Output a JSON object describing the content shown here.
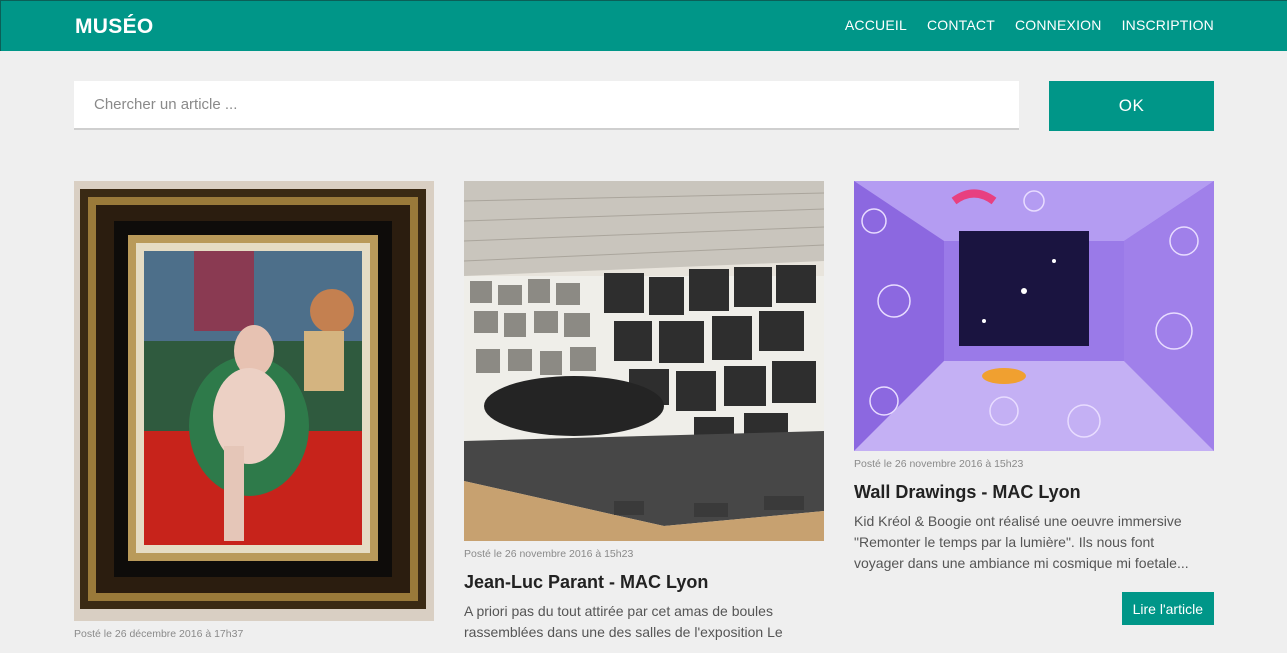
{
  "header": {
    "brand": "MUSÉO",
    "nav": [
      "ACCUEIL",
      "CONTACT",
      "CONNEXION",
      "INSCRIPTION"
    ]
  },
  "search": {
    "placeholder": "Chercher un article ...",
    "button_label": "OK"
  },
  "articles": [
    {
      "meta": "Posté le 26 décembre 2016 à 17h37",
      "title": "",
      "excerpt": ""
    },
    {
      "meta": "Posté le 26 novembre 2016 à 15h23",
      "title": "Jean-Luc Parant - MAC Lyon",
      "excerpt": "A priori pas du tout attirée par cet amas de boules rassemblées dans une des salles de l'exposition Le"
    },
    {
      "meta": "Posté le 26 novembre 2016 à 15h23",
      "title": "Wall Drawings - MAC Lyon",
      "excerpt": "Kid Kréol & Boogie ont réalisé une oeuvre immersive \"Remonter le temps par la lumière\". Ils nous font voyager dans une ambiance mi cosmique mi foetale...",
      "button_label": "Lire l'article"
    }
  ],
  "colors": {
    "accent": "#009688",
    "background": "#efefef"
  }
}
